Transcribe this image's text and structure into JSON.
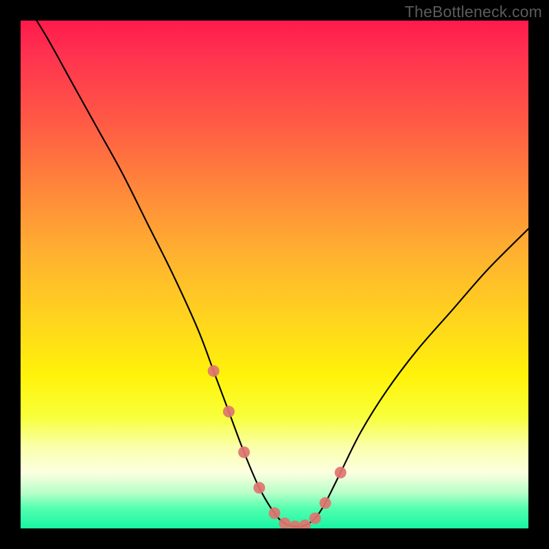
{
  "watermark": {
    "text": "TheBottleneck.com"
  },
  "chart_data": {
    "type": "line",
    "title": "",
    "xlabel": "",
    "ylabel": "",
    "xlim": [
      0,
      100
    ],
    "ylim": [
      0,
      100
    ],
    "grid": false,
    "legend": false,
    "series": [
      {
        "name": "bottleneck-curve",
        "x": [
          0,
          5,
          10,
          15,
          20,
          25,
          30,
          35,
          38,
          41,
          44,
          47,
          50,
          52,
          54,
          56,
          58,
          60,
          63,
          67,
          72,
          78,
          85,
          92,
          100
        ],
        "values": [
          105,
          97,
          88,
          79,
          70,
          60,
          50,
          39,
          31,
          23,
          15,
          8,
          3,
          1,
          0.4,
          0.6,
          2,
          5,
          11,
          19,
          27,
          35,
          43,
          51,
          59
        ]
      }
    ],
    "markers": {
      "name": "highlighted-points",
      "color": "#e0746f",
      "x": [
        38,
        41,
        44,
        47,
        50,
        52,
        54,
        56,
        58,
        60,
        63
      ],
      "values": [
        31,
        23,
        15,
        8,
        3,
        1,
        0.4,
        0.6,
        2,
        5,
        11
      ]
    },
    "background_gradient": {
      "top": "#ff1a4b",
      "bottom": "#17f5a2"
    }
  }
}
